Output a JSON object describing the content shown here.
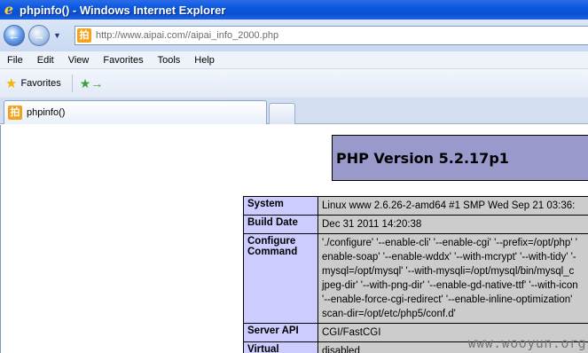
{
  "window": {
    "title": "phpinfo() - Windows Internet Explorer"
  },
  "address": {
    "url": "http://www.aipai.com//aipai_info_2000.php",
    "site_icon_glyph": "拍"
  },
  "menu": {
    "items": [
      "File",
      "Edit",
      "View",
      "Favorites",
      "Tools",
      "Help"
    ]
  },
  "favorites_bar": {
    "favorites_label": "Favorites"
  },
  "tabs": [
    {
      "label": "phpinfo()"
    }
  ],
  "php": {
    "header": "PHP Version 5.2.17p1",
    "rows": [
      {
        "key": "System",
        "value": "Linux www 2.6.26-2-amd64 #1 SMP Wed Sep 21 03:36:"
      },
      {
        "key": "Build Date",
        "value": "Dec 31 2011 14:20:38"
      },
      {
        "key": "Configure Command",
        "value": "'./configure' '--enable-cli' '--enable-cgi' '--prefix=/opt/php' '\nenable-soap' '--enable-wddx' '--with-mcrypt' '--with-tidy' '-\nmysql=/opt/mysql' '--with-mysqli=/opt/mysql/bin/mysql_c\njpeg-dir' '--with-png-dir' '--enable-gd-native-ttf' '--with-icon\n'--enable-force-cgi-redirect' '--enable-inline-optimization'\nscan-dir=/opt/etc/php5/conf.d'"
      },
      {
        "key": "Server API",
        "value": "CGI/FastCGI"
      },
      {
        "key": "Virtual",
        "value": "disabled"
      }
    ]
  },
  "watermark": "www.wooyun.org"
}
